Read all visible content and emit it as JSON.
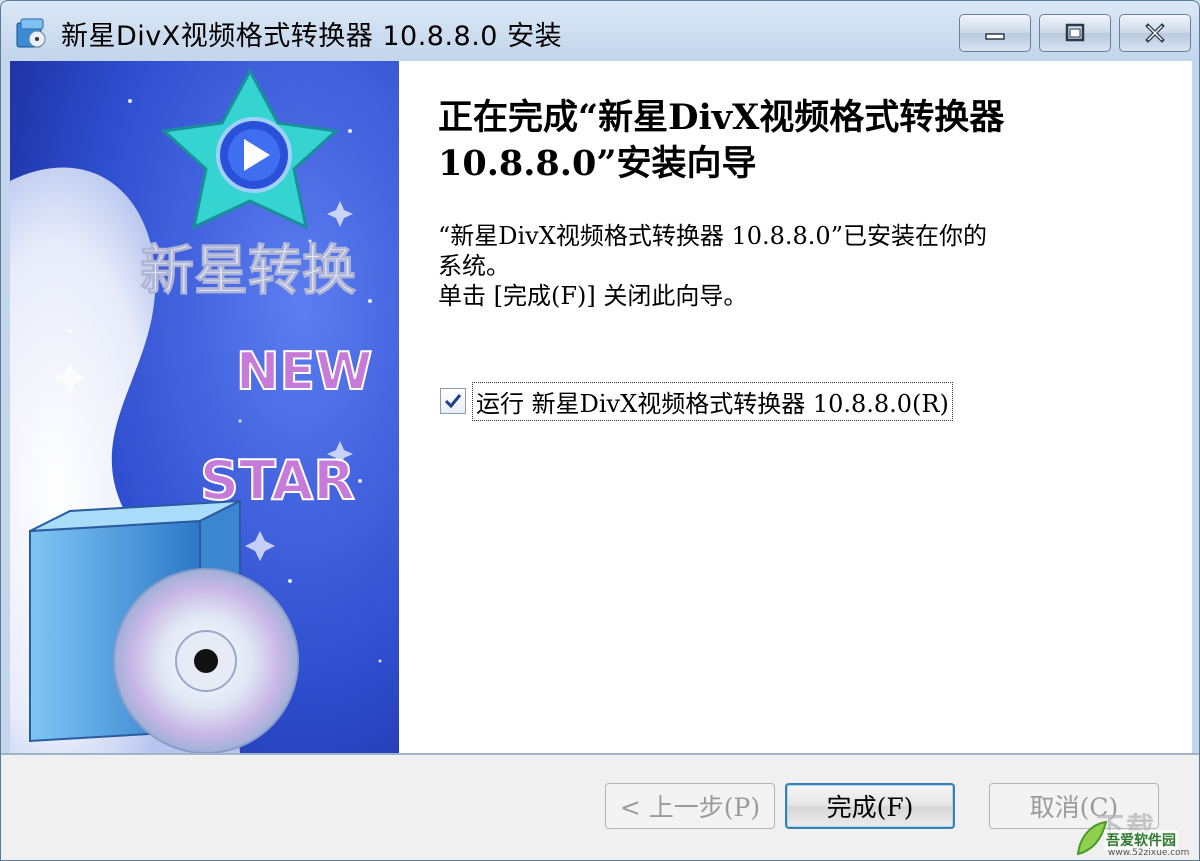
{
  "window": {
    "title": "新星DivX视频格式转换器 10.8.8.0 安装",
    "controls": {
      "minimize": "minimize-icon",
      "maximize": "maximize-icon",
      "close": "close-icon"
    }
  },
  "banner": {
    "text_cn": "新星转换",
    "text_new": "NEW",
    "text_star": "STAR"
  },
  "main": {
    "heading_line1": "正在完成“新星DivX视频格式转换器",
    "heading_line2": "10.8.8.0”安装向导",
    "desc_line1": "“新星DivX视频格式转换器 10.8.8.0”已安装在你的",
    "desc_line2": "系统。",
    "desc_line3": "单击 [完成(F)] 关闭此向导。",
    "run_checkbox": {
      "label": "运行 新星DivX视频格式转换器 10.8.8.0(R)",
      "checked": true
    }
  },
  "buttons": {
    "back": "< 上一步(P)",
    "finish": "完成(F)",
    "cancel": "取消(C)"
  },
  "watermark": {
    "line1": "下载",
    "line2": "吾爱软件园",
    "line3": "www.52zixue.com"
  },
  "colors": {
    "banner_blue": "#2f4fd0",
    "star_cyan": "#35d4d0",
    "text_purple": "#c77bd8"
  }
}
